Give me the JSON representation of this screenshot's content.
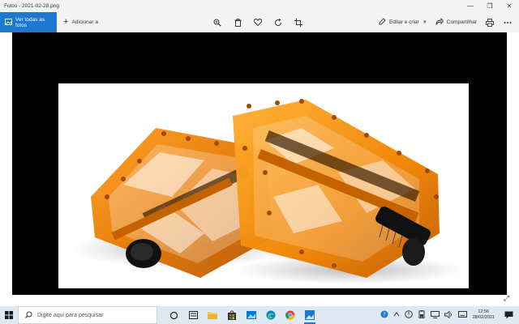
{
  "window": {
    "title": "Fotos - 2021-02-28.png",
    "minimize": "—",
    "restore": "❐",
    "close": "✕"
  },
  "toolbar": {
    "see_all_label": "Ver todas as fotos",
    "add_label": "Adicionar a",
    "center_icons": [
      "zoom-in-icon",
      "delete-icon",
      "favorite-icon",
      "rotate-icon",
      "crop-icon"
    ],
    "edit_label": "Editar e criar",
    "share_label": "Compartilhar",
    "accent": "#1c78d0"
  },
  "viewer": {
    "background": "#000000",
    "image_subject": "orange translucent bicycle pedals",
    "expand_glyph": "⤢"
  },
  "taskbar": {
    "search_placeholder": "Digite aqui para pesquisar",
    "apps": [
      "task-view-icon",
      "widgets-icon",
      "file-explorer-icon",
      "store-icon",
      "edge-icon",
      "chrome-icon",
      "photos-icon"
    ],
    "time": "12:56",
    "date": "28/02/2021"
  }
}
